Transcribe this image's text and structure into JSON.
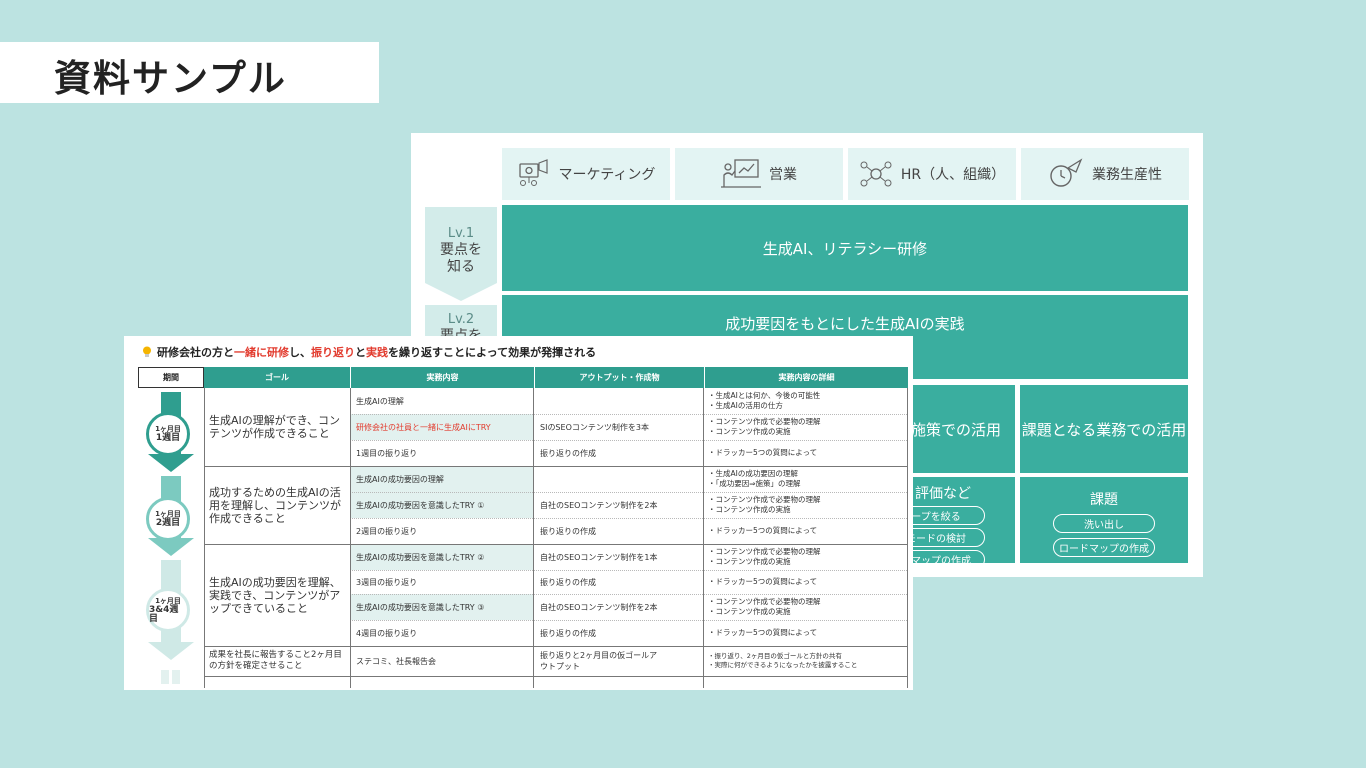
{
  "page_title": "資料サンプル",
  "back_slide": {
    "categories": [
      "マーケティング",
      "営業",
      "HR（人、組織）",
      "業務生産性"
    ],
    "levels": [
      {
        "name": "Lv.1",
        "desc": "要点を知る"
      },
      {
        "name": "Lv.2",
        "desc": "要点を"
      }
    ],
    "lv1_block": "生成AI、リテラシー研修",
    "lv2_block": "成功要因をもとにした生成AIの実践",
    "mid_left": "R施策での活用",
    "mid_right": "課題となる業務での活用",
    "bottom_left_title": "評価など",
    "bottom_left_pills": [
      "ープを絞る",
      "モードの検討",
      "ドマップの作成"
    ],
    "bottom_right_title": "課題",
    "bottom_right_pills": [
      "洗い出し",
      "ロードマップの作成"
    ],
    "colors": {
      "teal": "#3aae9f",
      "light": "#e3f4f3"
    }
  },
  "front_slide": {
    "headline_parts": [
      "研修会社の方と",
      "一緒に研修",
      "し、",
      "振り返り",
      "と",
      "実践",
      "を繰り返すことによって効果が発揮される"
    ],
    "headers": {
      "period": "期間",
      "goal": "ゴール",
      "task": "実務内容",
      "output": "アウトプット・作成物",
      "detail": "実務内容の詳細"
    },
    "periods": [
      {
        "line1": "1ヶ月目",
        "line2": "1週目"
      },
      {
        "line1": "1ヶ月目",
        "line2": "2週目"
      },
      {
        "line1": "1ヶ月目",
        "line2": "3&4週目"
      }
    ],
    "goals": [
      "生成AIの理解ができ、コンテンツが作成できること",
      "成功するための生成AIの活用を理解し、コンテンツが作成できること",
      "生成AIの成功要因を理解、実践でき、コンテンツがアップできていること",
      "成果を社長に報告すること2ヶ月目の方針を確定させること"
    ],
    "rows": [
      {
        "task": "生成AIの理解",
        "output": "",
        "detail": [
          "・生成AIとは何か、今後の可能性",
          "・生成AIの活用の仕方"
        ]
      },
      {
        "task": "研修会社の社員と一緒に生成AIにTRY",
        "output": "SIのSEOコンテンツ制作を3本",
        "detail": [
          "・コンテンツ作成で必要物の理解",
          "・コンテンツ作成の実施"
        ]
      },
      {
        "task": "1週目の振り返り",
        "output": "振り返りの作成",
        "detail": [
          "・ドラッカー5つの質問によって"
        ]
      },
      {
        "task": "生成AIの成功要因の理解",
        "output": "",
        "detail": [
          "・生成AIの成功要因の理解",
          "・「成功要因⇒施策」の理解"
        ]
      },
      {
        "task": "生成AIの成功要因を意識したTRY ①",
        "output": "自社のSEOコンテンツ制作を2本",
        "detail": [
          "・コンテンツ作成で必要物の理解",
          "・コンテンツ作成の実施"
        ]
      },
      {
        "task": "2週目の振り返り",
        "output": "振り返りの作成",
        "detail": [
          "・ドラッカー5つの質問によって"
        ]
      },
      {
        "task": "生成AIの成功要因を意識したTRY ②",
        "output": "自社のSEOコンテンツ制作を1本",
        "detail": [
          "・コンテンツ作成で必要物の理解",
          "・コンテンツ作成の実施"
        ]
      },
      {
        "task": "3週目の振り返り",
        "output": "振り返りの作成",
        "detail": [
          "・ドラッカー5つの質問によって"
        ]
      },
      {
        "task": "生成AIの成功要因を意識したTRY ③",
        "output": "自社のSEOコンテンツ制作を2本",
        "detail": [
          "・コンテンツ作成で必要物の理解",
          "・コンテンツ作成の実施"
        ]
      },
      {
        "task": "4週目の振り返り",
        "output": "振り返りの作成",
        "detail": [
          "・ドラッカー5つの質問によって"
        ]
      },
      {
        "task": "ステコミ、社長報告会",
        "output": "振り返りと2ヶ月目の仮ゴールアウトプット",
        "detail": [
          "・振り返り、2ヶ月目の仮ゴールと方針の共有",
          "・実際に何ができるようになったかを披露すること"
        ]
      }
    ]
  }
}
